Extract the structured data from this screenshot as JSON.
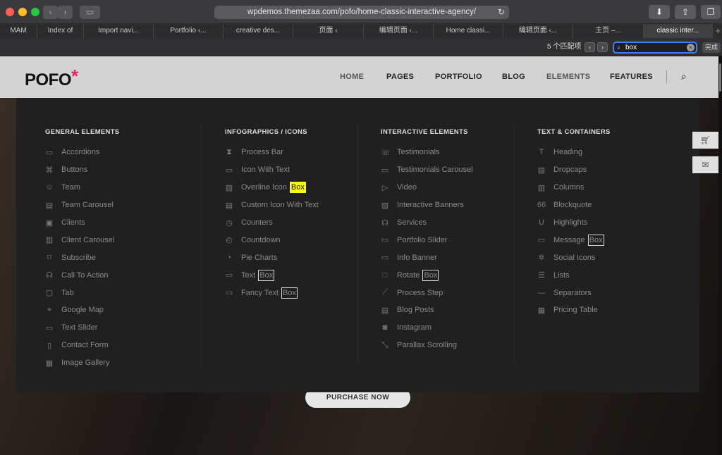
{
  "browser": {
    "url": "wpdemos.themezaa.com/pofo/home-classic-interactive-agency/",
    "tabs": [
      "MAM",
      "Index of",
      "Import navi...",
      "Portfolio ‹...",
      "creative des...",
      "页面 ‹",
      "编辑页面 ‹...",
      "Home classi...",
      "编辑页面 ‹...",
      "主页 –...",
      "classic inter..."
    ],
    "active_tab_index": 10
  },
  "find": {
    "count_label": "5 个匹配项",
    "query": "box",
    "done_label": "完成"
  },
  "site": {
    "logo": "POFO",
    "logo_mark": "*",
    "nav": [
      "HOME",
      "PAGES",
      "PORTFOLIO",
      "BLOG",
      "ELEMENTS",
      "FEATURES"
    ],
    "cta_label": "PURCHASE NOW"
  },
  "mega_menu": {
    "columns": [
      {
        "title": "GENERAL ELEMENTS",
        "items": [
          {
            "label": "Accordions",
            "icon": "accordion-icon"
          },
          {
            "label": "Buttons",
            "icon": "mouse-icon"
          },
          {
            "label": "Team",
            "icon": "user-icon"
          },
          {
            "label": "Team Carousel",
            "icon": "card-icon"
          },
          {
            "label": "Clients",
            "icon": "id-icon"
          },
          {
            "label": "Client Carousel",
            "icon": "carousel-icon"
          },
          {
            "label": "Subscribe",
            "icon": "bookmark-icon"
          },
          {
            "label": "Call To Action",
            "icon": "headset-icon"
          },
          {
            "label": "Tab",
            "icon": "folder-icon"
          },
          {
            "label": "Google Map",
            "icon": "pin-icon"
          },
          {
            "label": "Text Slider",
            "icon": "slider-icon"
          },
          {
            "label": "Contact Form",
            "icon": "clipboard-icon"
          },
          {
            "label": "Image Gallery",
            "icon": "gallery-icon"
          }
        ]
      },
      {
        "title": "INFOGRAPHICS / ICONS",
        "items": [
          {
            "label": "Process Bar",
            "icon": "hourglass-icon"
          },
          {
            "label": "Icon With Text",
            "icon": "icon-text-icon"
          },
          {
            "label": "Overline Icon ",
            "hl": "Box",
            "hl_current": true,
            "icon": "image-box-icon"
          },
          {
            "label": "Custom Icon With Text",
            "icon": "card-icon"
          },
          {
            "label": "Counters",
            "icon": "timer-icon"
          },
          {
            "label": "Countdown",
            "icon": "alarm-icon"
          },
          {
            "label": "Pie Charts",
            "icon": "pie-icon"
          },
          {
            "label": "Text ",
            "hl": "Box",
            "icon": "textbox-icon"
          },
          {
            "label": "Fancy Text ",
            "hl": "Box",
            "icon": "fancy-textbox-icon"
          }
        ]
      },
      {
        "title": "INTERACTIVE ELEMENTS",
        "items": [
          {
            "label": "Testimonials",
            "icon": "chat-icon"
          },
          {
            "label": "Testimonials Carousel",
            "icon": "chat-bubble-icon"
          },
          {
            "label": "Video",
            "icon": "video-icon"
          },
          {
            "label": "Interactive Banners",
            "icon": "image-icon"
          },
          {
            "label": "Services",
            "icon": "headset-icon"
          },
          {
            "label": "Portfolio Slider",
            "icon": "slider-icon"
          },
          {
            "label": "Info Banner",
            "icon": "banner-icon"
          },
          {
            "label": "Rotate ",
            "hl": "Box",
            "icon": "square-icon"
          },
          {
            "label": "Process Step",
            "icon": "chart-line-icon"
          },
          {
            "label": "Blog Posts",
            "icon": "posts-icon"
          },
          {
            "label": "Instagram",
            "icon": "instagram-icon"
          },
          {
            "label": "Parallax Scrolling",
            "icon": "arrows-icon"
          }
        ]
      },
      {
        "title": "TEXT & CONTAINERS",
        "items": [
          {
            "label": "Heading",
            "icon": "heading-icon"
          },
          {
            "label": "Dropcaps",
            "icon": "dropcap-icon"
          },
          {
            "label": "Columns",
            "icon": "columns-icon"
          },
          {
            "label": "Blockquote",
            "icon": "quote-icon"
          },
          {
            "label": "Highlights",
            "icon": "highlight-icon"
          },
          {
            "label": "Message ",
            "hl": "Box",
            "icon": "monitor-icon"
          },
          {
            "label": "Social Icons",
            "icon": "social-icon"
          },
          {
            "label": "Lists",
            "icon": "list-icon"
          },
          {
            "label": "Separators",
            "icon": "separator-icon"
          },
          {
            "label": "Pricing Table",
            "icon": "table-icon"
          }
        ]
      }
    ]
  }
}
